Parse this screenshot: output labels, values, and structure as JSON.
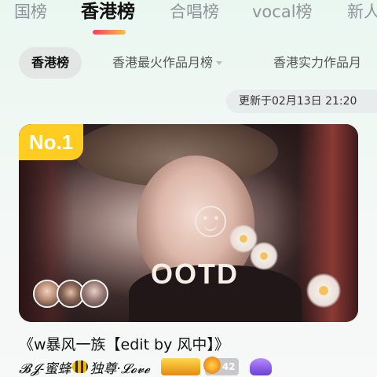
{
  "top_tabs": [
    {
      "label": "国榜",
      "active": false
    },
    {
      "label": "香港榜",
      "active": true
    },
    {
      "label": "合唱榜",
      "active": false
    },
    {
      "label": "vocal榜",
      "active": false
    },
    {
      "label": "新人",
      "active": false
    }
  ],
  "sub_tabs": [
    {
      "label": "香港榜",
      "active": true
    },
    {
      "label": "香港最火作品月榜",
      "has_dropdown": true
    },
    {
      "label": "香港实力作品月"
    }
  ],
  "updated_text": "更新于02月13日 21:20",
  "card": {
    "rank": "No.1",
    "overlay_text": "OOTD",
    "avatar_count": 3
  },
  "song": {
    "title": "《w暴风一族【edit by 风中】》",
    "author_prefix": "𝓑𝓙-蜜蜂",
    "author_suffix": "独尊·𝓛𝓸𝓿𝓮",
    "level": "42"
  },
  "colors": {
    "accent_gradient_start": "#ff3a63",
    "accent_gradient_end": "#ffbf3a",
    "rank_badge": "#ffcc22"
  }
}
